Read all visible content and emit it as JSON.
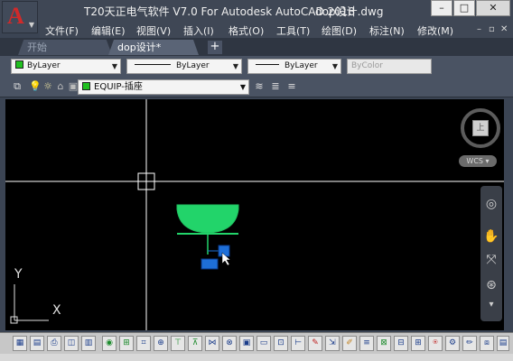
{
  "titlebar": {
    "app_logo": "A",
    "app_name": "T20天正电气软件 V7.0 For Autodesk AutoCAD 2018",
    "filename": "dop设计.dwg",
    "minimize": "–",
    "maximize": "□",
    "close": "✕"
  },
  "menu": {
    "items": [
      "文件(F)",
      "编辑(E)",
      "视图(V)",
      "插入(I)",
      "格式(O)",
      "工具(T)",
      "绘图(D)",
      "标注(N)",
      "修改(M)"
    ],
    "controls": [
      "–",
      "▫",
      "✕"
    ]
  },
  "tabs": {
    "start": "开始",
    "doc": "dop设计*",
    "add": "+"
  },
  "properties": {
    "color": "ByLayer",
    "linetype": "ByLayer",
    "lineweight": "ByLayer",
    "plotstyle": "ByColor"
  },
  "layer": {
    "current": "EQUIP-插座"
  },
  "viewport": {
    "viewcube_face": "上",
    "wcs": "WCS ▾",
    "ucs_x": "X",
    "ucs_y": "Y"
  },
  "colors": {
    "canvas_bg": "#000000",
    "crosshair": "#ffffff",
    "symbol_fill": "#22d46a",
    "grip_blue": "#1e6fd8",
    "layer_swatch": "#21c021",
    "app_logo": "#d12a2a"
  },
  "bottom_toolbar": {
    "icons": [
      "save-as-icon",
      "save-icon",
      "plot-icon",
      "preview-icon",
      "table-icon",
      "target-icon",
      "grid-icon",
      "snap-icon",
      "zoom-icon",
      "equip-icon",
      "panel-icon",
      "switch-icon",
      "lamp-icon",
      "rect-icon",
      "wire-icon",
      "route-icon",
      "break-icon",
      "edit-icon",
      "measure-icon",
      "legend-icon",
      "dim-icon",
      "text-icon",
      "check-icon",
      "bus-icon",
      "meter-icon",
      "setting-icon",
      "pen-icon",
      "help-icon"
    ]
  }
}
